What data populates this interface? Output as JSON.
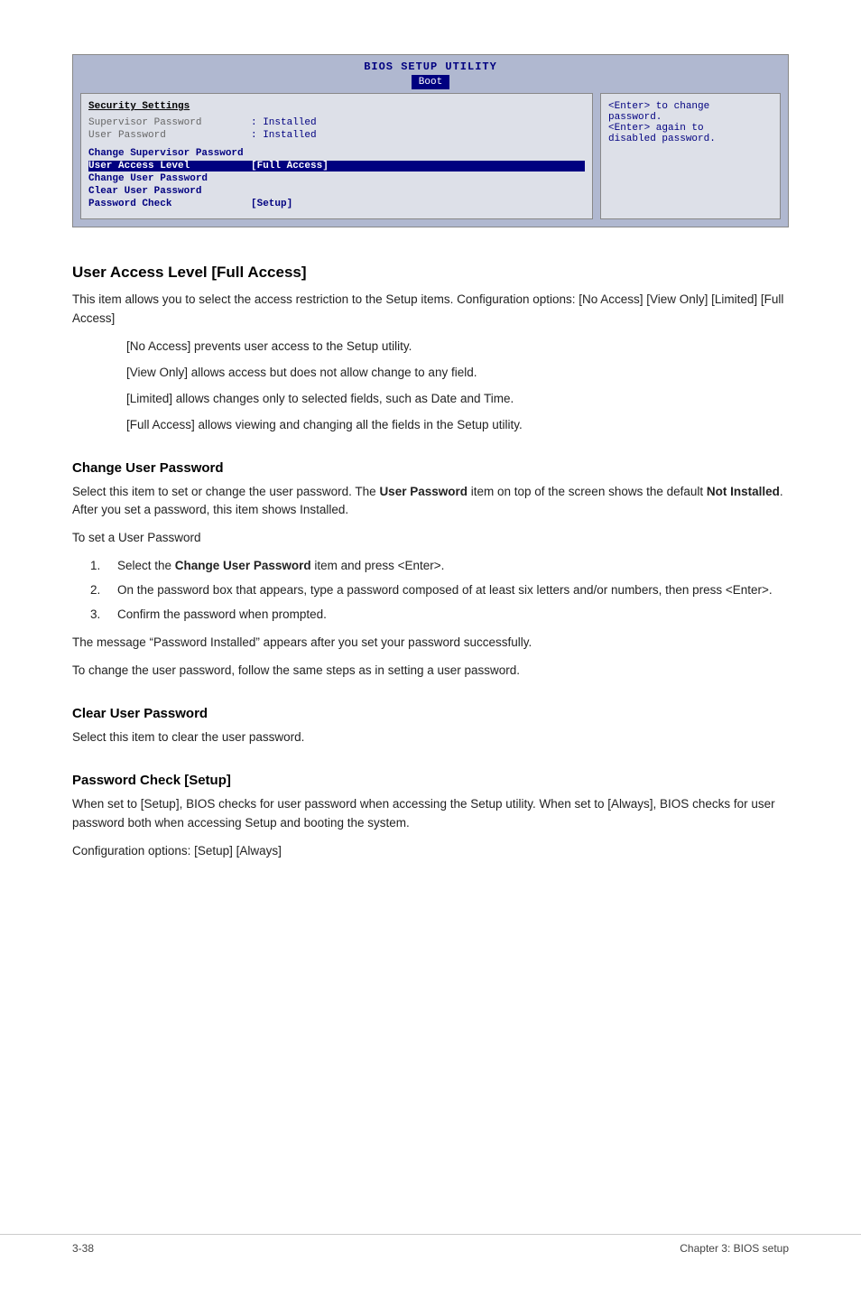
{
  "bios": {
    "title": "BIOS SETUP UTILITY",
    "active_tab": "Boot",
    "tabs": [
      "Boot"
    ],
    "section_title": "Security Settings",
    "rows": [
      {
        "label": "Supervisor Password",
        "value": ": Installed",
        "type": "dim"
      },
      {
        "label": "User Password",
        "value": ": Installed",
        "type": "dim"
      },
      {
        "label": "",
        "value": "",
        "type": "spacer"
      },
      {
        "label": "Change Supervisor Password",
        "value": "",
        "type": "highlight"
      },
      {
        "label": "User Access Level",
        "value": "[Full Access]",
        "type": "selected"
      },
      {
        "label": "Change User Password",
        "value": "",
        "type": "highlight"
      },
      {
        "label": "Clear User Password",
        "value": "",
        "type": "highlight"
      },
      {
        "label": "Password Check",
        "value": "[Setup]",
        "type": "highlight"
      }
    ],
    "sidebar_lines": [
      "<Enter> to change",
      "password.",
      "<Enter> again to",
      "disabled password."
    ]
  },
  "sections": [
    {
      "id": "user-access-level",
      "heading": "User Access Level [Full Access]",
      "paragraphs": [
        "This item allows you to select the access restriction to the Setup items. Configuration options: [No Access] [View Only] [Limited] [Full Access]"
      ],
      "indented": [
        "[No Access] prevents user access to the Setup utility.",
        "[View Only] allows access but does not allow change to any field.",
        "[Limited] allows changes only to selected fields, such as Date and Time.",
        "[Full Access] allows viewing and changing all the fields in the Setup utility."
      ]
    },
    {
      "id": "change-user-password",
      "heading": "Change User Password",
      "paragraphs": [
        "Select this item to set or change the user password. The **User Password** item on top of the screen shows the default **Not Installed**. After you set a password, this item shows Installed.",
        "To set a User Password"
      ],
      "numbered": [
        {
          "num": "1.",
          "text": "Select the **Change User Password** item and press <Enter>."
        },
        {
          "num": "2.",
          "text": "On the password box that appears, type a password composed of at least six letters and/or numbers, then press <Enter>."
        },
        {
          "num": "3.",
          "text": "Confirm the password when prompted."
        }
      ],
      "after_numbered": [
        "The message “Password Installed” appears after you set your password successfully.",
        "To change the user password, follow the same steps as in setting a user password."
      ]
    },
    {
      "id": "clear-user-password",
      "heading": "Clear User Password",
      "paragraphs": [
        "Select this item to clear the user password."
      ]
    },
    {
      "id": "password-check",
      "heading": "Password Check [Setup]",
      "paragraphs": [
        "When set to [Setup], BIOS checks for user password when accessing the Setup utility. When set to [Always], BIOS checks for user password both when accessing Setup and booting the system.",
        "Configuration options: [Setup] [Always]"
      ]
    }
  ],
  "footer": {
    "left": "3-38",
    "right": "Chapter 3: BIOS setup"
  }
}
